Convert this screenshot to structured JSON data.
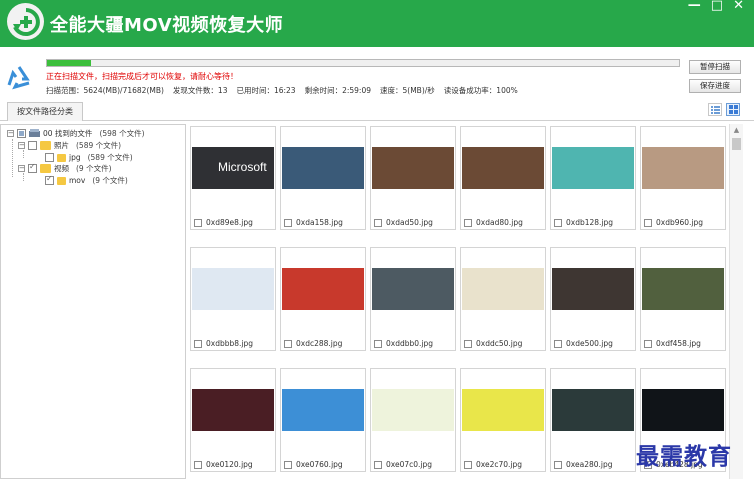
{
  "app": {
    "title": "全能大疆MOV视频恢复大师"
  },
  "window_controls": {
    "minimize": "—",
    "maximize": "□",
    "close": "✕"
  },
  "scan": {
    "progress_fraction": 0.07,
    "warning": "正在扫描文件，扫描完成后才可以恢复，请耐心等待！",
    "stats": {
      "range": "扫描范围：5624(MB)/71682(MB)",
      "found": "发现文件数：13",
      "elapsed": "已用时间：16:23",
      "remaining": "剩余时间：2:59:09",
      "speed": "速度：5(MB)/秒",
      "read_rate": "读设备成功率：100%"
    }
  },
  "buttons": {
    "pause": "暂停扫描",
    "save_progress": "保存进度"
  },
  "tabs": {
    "by_path": "按文件路径分类"
  },
  "tree": {
    "root": {
      "label": "00 找到的文件",
      "count": "(598 个文件)"
    },
    "photos": {
      "label": "照片",
      "count": "(589 个文件)"
    },
    "jpg": {
      "label": "jpg",
      "count": "(589 个文件)"
    },
    "videos": {
      "label": "视频",
      "count": "(9 个文件)"
    },
    "mov": {
      "label": "mov",
      "count": "(9 个文件)"
    }
  },
  "thumbnails": [
    {
      "name": "0xd89e8.jpg",
      "color": "#2f3034"
    },
    {
      "name": "0xda158.jpg",
      "color": "#3a5a78"
    },
    {
      "name": "0xdad50.jpg",
      "color": "#6b4a35"
    },
    {
      "name": "0xdad80.jpg",
      "color": "#6b4a35"
    },
    {
      "name": "0xdb128.jpg",
      "color": "#4fb5b0"
    },
    {
      "name": "0xdb960.jpg",
      "color": "#b89a82"
    },
    {
      "name": "0xdbbb8.jpg",
      "color": "#dfe8f2"
    },
    {
      "name": "0xdc288.jpg",
      "color": "#c8392c"
    },
    {
      "name": "0xddbb0.jpg",
      "color": "#4d5a62"
    },
    {
      "name": "0xddc50.jpg",
      "color": "#e9e2cc"
    },
    {
      "name": "0xde500.jpg",
      "color": "#3e3632"
    },
    {
      "name": "0xdf458.jpg",
      "color": "#51603e"
    },
    {
      "name": "0xe0120.jpg",
      "color": "#4a1e24"
    },
    {
      "name": "0xe0760.jpg",
      "color": "#3d8fd6"
    },
    {
      "name": "0xe07c0.jpg",
      "color": "#eef3dc"
    },
    {
      "name": "0xe2c70.jpg",
      "color": "#e9e64a"
    },
    {
      "name": "0xea280.jpg",
      "color": "#2b3a3a"
    },
    {
      "name": "0xeb428.jpg",
      "color": "#101418"
    }
  ],
  "thumbnail_text": {
    "microsoft_logo": "Microsoft"
  },
  "watermark": "最需教育"
}
